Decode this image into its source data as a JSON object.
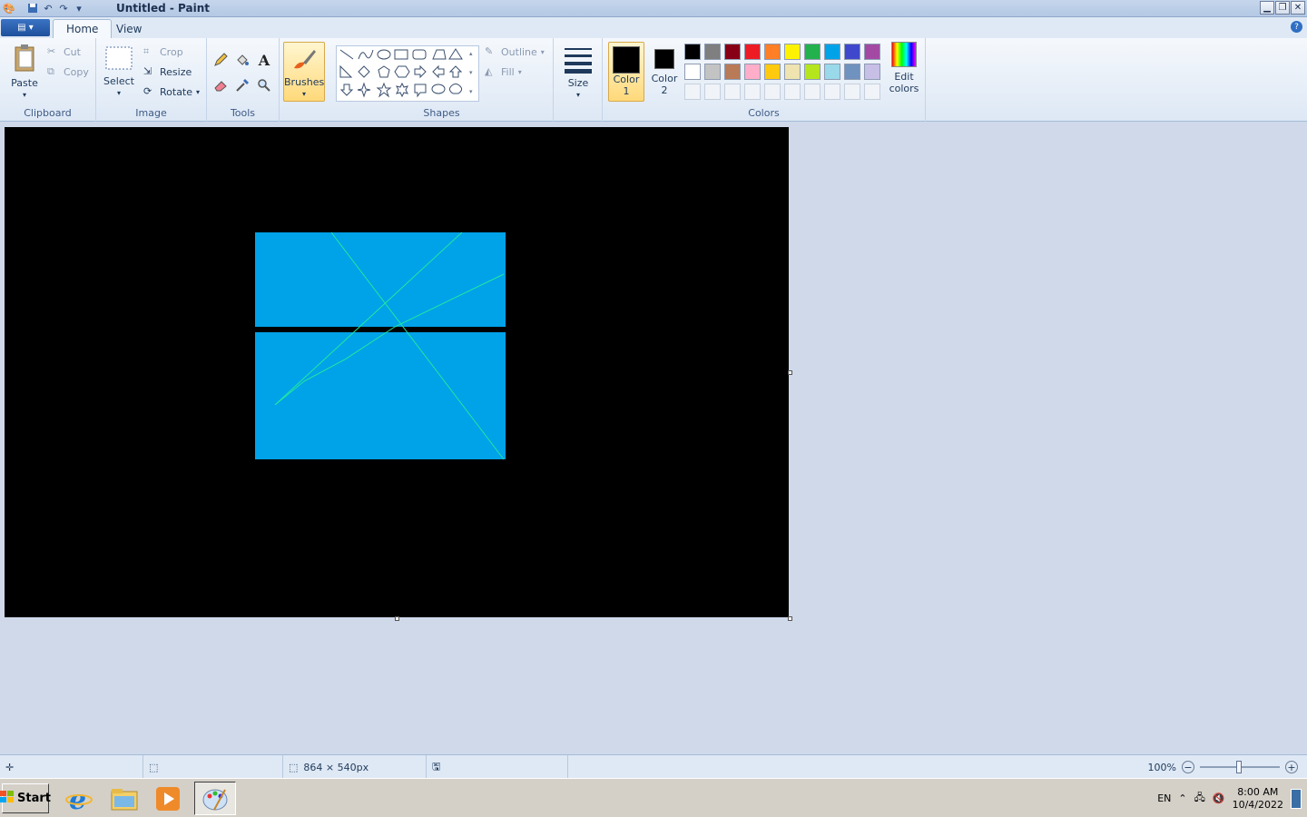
{
  "window": {
    "title": "Untitled - Paint"
  },
  "tabs": [
    {
      "label": "Home",
      "active": true
    },
    {
      "label": "View",
      "active": false
    }
  ],
  "ribbon": {
    "clipboard": {
      "label": "Clipboard",
      "paste": "Paste",
      "cut": "Cut",
      "copy": "Copy"
    },
    "image": {
      "label": "Image",
      "select": "Select",
      "crop": "Crop",
      "resize": "Resize",
      "rotate": "Rotate"
    },
    "tools": {
      "label": "Tools",
      "items": [
        "pencil-icon",
        "fill-bucket-icon",
        "text-icon",
        "eraser-icon",
        "color-picker-icon",
        "magnifier-icon"
      ]
    },
    "brushes": {
      "label": "Brushes"
    },
    "shapes": {
      "label": "Shapes",
      "outline": "Outline",
      "fill": "Fill"
    },
    "size": {
      "label": "Size"
    },
    "colors": {
      "label": "Colors",
      "color1_line1": "Color",
      "color1_line2": "1",
      "color2_line1": "Color",
      "color2_line2": "2",
      "edit_line1": "Edit",
      "edit_line2": "colors",
      "color1": "#000000",
      "color2": "#000000",
      "palette_row1": [
        "#000000",
        "#7f7f7f",
        "#880015",
        "#ed1c24",
        "#ff7f27",
        "#fff200",
        "#22b14c",
        "#00a2e8",
        "#3f48cc",
        "#a349a4"
      ],
      "palette_row2": [
        "#ffffff",
        "#c3c3c3",
        "#b97a57",
        "#ffaec9",
        "#ffc90e",
        "#efe4b0",
        "#b5e61d",
        "#99d9ea",
        "#7092be",
        "#c8bfe7"
      ]
    }
  },
  "canvas": {
    "background": "#000000",
    "rect_fill": "#00a2e8",
    "line_color": "#22e8a0"
  },
  "status": {
    "dimensions": "864 × 540px",
    "zoom": "100%"
  },
  "taskbar": {
    "start": "Start",
    "language": "EN",
    "time": "8:00 AM",
    "date": "10/4/2022"
  }
}
